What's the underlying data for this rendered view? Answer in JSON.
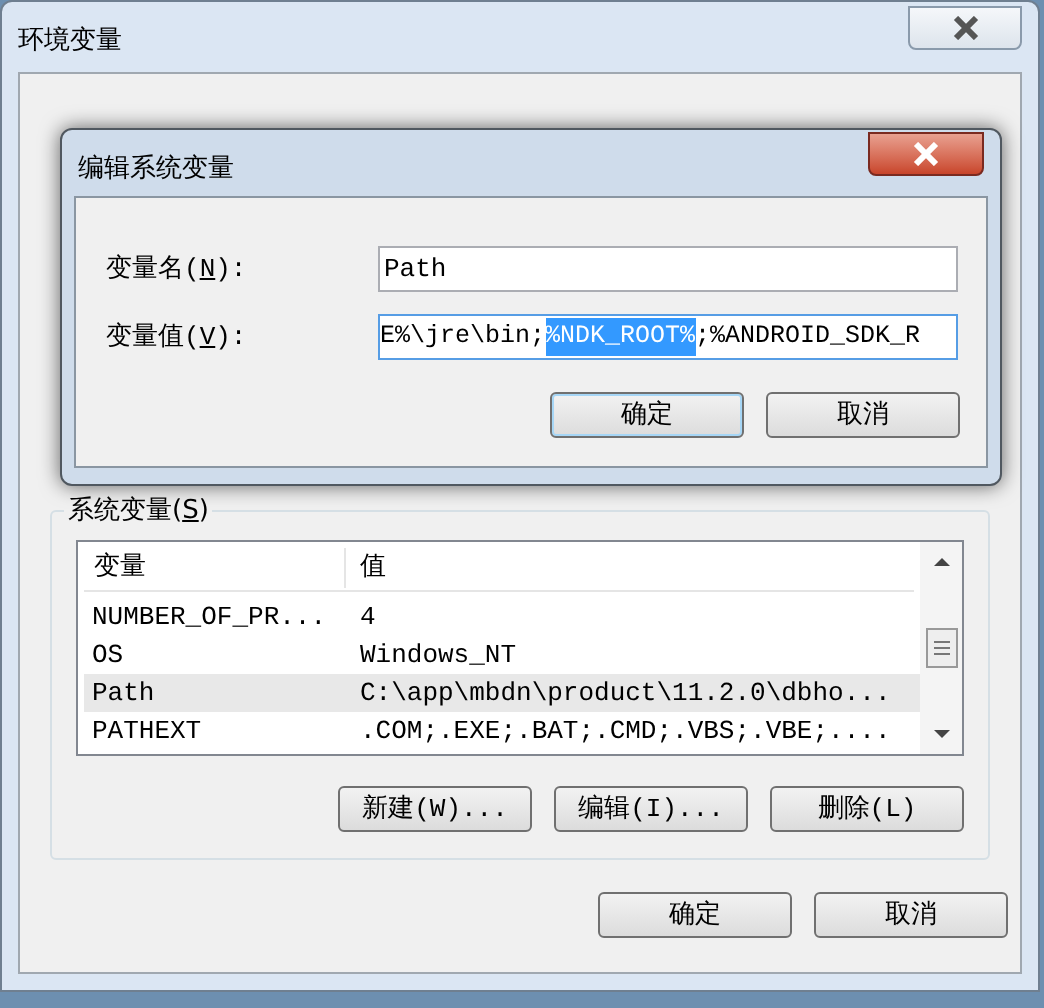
{
  "window": {
    "title": "环境变量"
  },
  "edit_dialog": {
    "title": "编辑系统变量",
    "name_label": "变量名(N):",
    "name_value": "Path",
    "value_label": "变量值(V):",
    "value": {
      "before": "E%\\jre\\bin;",
      "selection": "%NDK_ROOT%",
      "after": ";%ANDROID_SDK_R"
    },
    "buttons": [
      {
        "label": "确定",
        "default": true
      },
      {
        "label": "取消",
        "default": false
      }
    ]
  },
  "system_variables": {
    "title": "系统变量(S)",
    "columns": [
      "变量",
      "值"
    ],
    "rows": [
      {
        "name": "NUMBER_OF_PR...",
        "value": "4",
        "selected": false
      },
      {
        "name": "OS",
        "value": "Windows_NT",
        "selected": false
      },
      {
        "name": "Path",
        "value": "C:\\app\\mbdn\\product\\11.2.0\\dbho...",
        "selected": true
      },
      {
        "name": "PATHEXT",
        "value": ".COM;.EXE;.BAT;.CMD;.VBS;.VBE;....",
        "selected": false
      }
    ],
    "buttons": [
      "新建(W)...",
      "编辑(I)...",
      "删除(L)"
    ]
  },
  "buttons": [
    "确定",
    "取消"
  ]
}
